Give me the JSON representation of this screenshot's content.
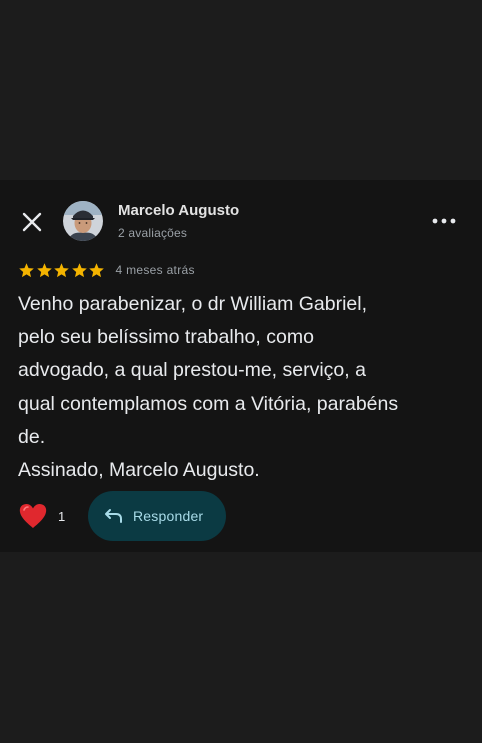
{
  "header": {
    "close_icon": "close-icon",
    "more_icon": "more-horizontal-icon"
  },
  "review": {
    "author_name": "Marcelo Augusto",
    "author_meta": "2 avaliações",
    "rating": 5,
    "rating_max": 5,
    "time_ago": "4 meses atrás",
    "text": "Venho parabenizar, o dr William Gabriel,\npelo seu belíssimo trabalho, como\nadvogado, a qual prestou-me, serviço, a\nqual contemplamos com a Vitória, parabéns\nde.\nAssinado, Marcelo Augusto.",
    "star_color": "#f4b400"
  },
  "actions": {
    "like_icon": "heart-icon",
    "like_count": "1",
    "reply_icon": "reply-icon",
    "reply_label": "Responder",
    "reply_bg_color": "#0b3a43",
    "reply_text_color": "#a8dbe8",
    "heart_color": "#e0282e"
  }
}
